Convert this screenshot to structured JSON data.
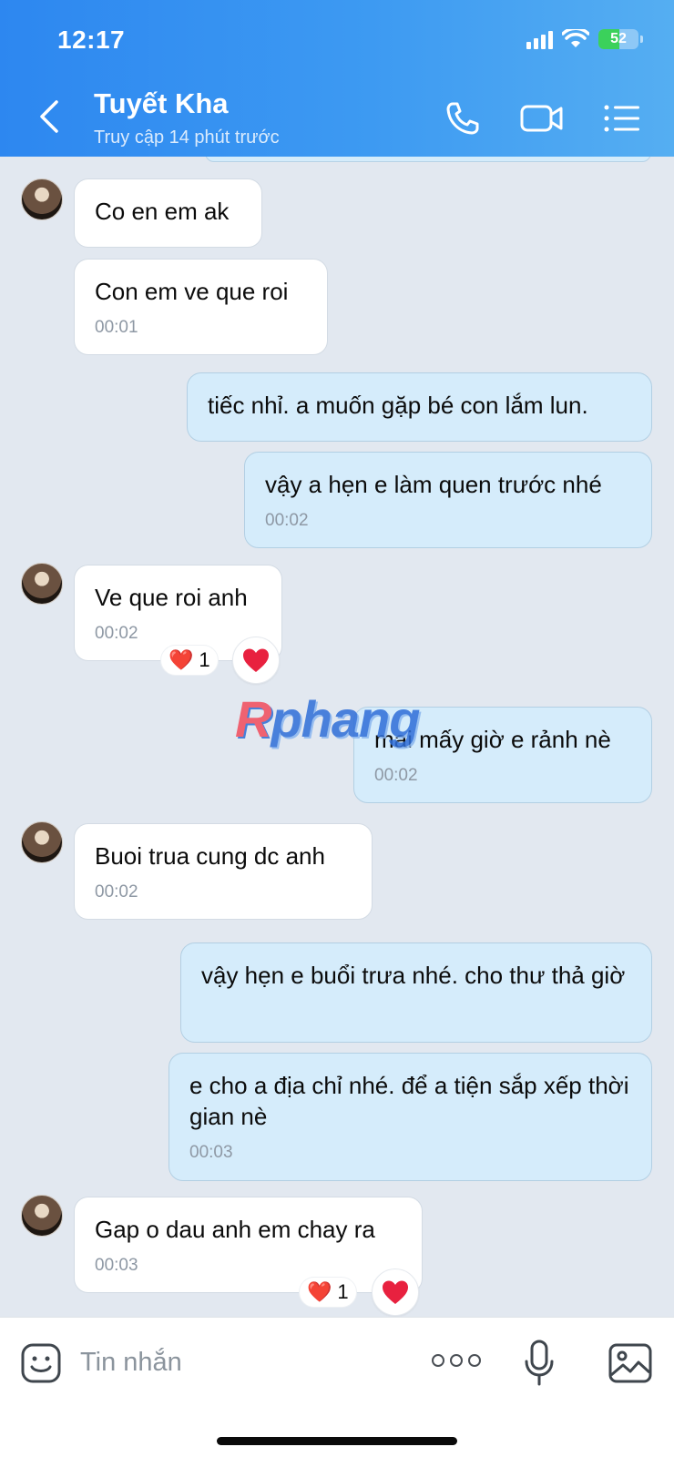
{
  "status_bar": {
    "time": "12:17",
    "battery": "52",
    "battery_level": 0.52
  },
  "header": {
    "contact_name": "Tuyết Kha",
    "contact_status": "Truy cập 14 phút trước"
  },
  "messages": [
    {
      "side": "in",
      "text": "Co en em ak",
      "time": ""
    },
    {
      "side": "in",
      "text": "Con em ve que roi",
      "time": "00:01"
    },
    {
      "side": "out",
      "text": "tiếc nhỉ. a muốn gặp bé con lắm lun.",
      "time": ""
    },
    {
      "side": "out",
      "text": "vậy a hẹn e làm quen trước nhé",
      "time": "00:02"
    },
    {
      "side": "in",
      "text": "Ve que roi anh",
      "time": "00:02",
      "reaction": {
        "emoji": "❤️",
        "count": "1"
      }
    },
    {
      "side": "out",
      "text": "mai mấy giờ e rảnh nè",
      "time": "00:02"
    },
    {
      "side": "in",
      "text": "Buoi trua cung dc anh",
      "time": "00:02"
    },
    {
      "side": "out",
      "text": "vậy hẹn e buổi trưa nhé. cho thư thả giờ",
      "time": ""
    },
    {
      "side": "out",
      "text": "e cho a địa chỉ nhé. để a tiện sắp xếp thời gian nè",
      "time": "00:03"
    },
    {
      "side": "in",
      "text": "Gap o dau anh em chay ra",
      "time": "00:03",
      "reaction": {
        "emoji": "❤️",
        "count": "1"
      }
    }
  ],
  "watermark": {
    "part1": "R",
    "part2": "phang"
  },
  "input": {
    "placeholder": "Tin nhắn"
  },
  "colors": {
    "header_gradient_start": "#2d87f0",
    "header_gradient_end": "#55aef2",
    "chat_background": "#e2e8f0",
    "outgoing_bubble": "#d5ecfb",
    "incoming_bubble": "#ffffff",
    "heart": "#e8213f"
  }
}
